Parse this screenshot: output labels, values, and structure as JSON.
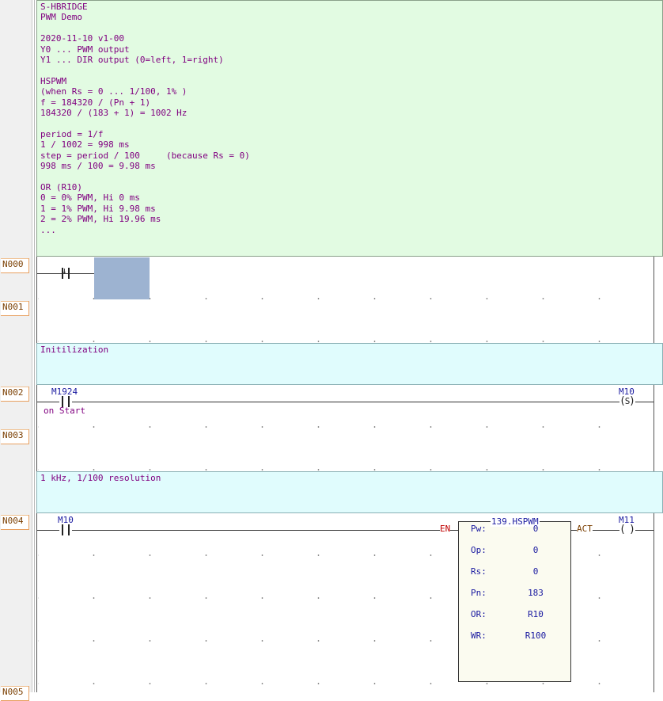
{
  "header_comment": {
    "lines": [
      "S-HBRIDGE",
      "PWM Demo",
      "",
      "2020-11-10 v1-00",
      "Y0 ... PWM output",
      "Y1 ... DIR output (0=left, 1=right)",
      "",
      "HSPWM",
      "(when Rs = 0 ... 1/100, 1% )",
      "f = 184320 / (Pn + 1)",
      "184320 / (183 + 1) = 1002 Hz",
      "",
      "period = 1/f",
      "1 / 1002 = 998 ms",
      "step = period / 100     (because Rs = 0)",
      "998 ms / 100 = 9.98 ms",
      "",
      "OR (R10)",
      "0 = 0% PWM, Hi 0 ms",
      "1 = 1% PWM, Hi 9.98 ms",
      "2 = 2% PWM, Hi 19.96 ms",
      "..."
    ]
  },
  "networks": {
    "n000": "N000",
    "n001": "N001",
    "n002": "N002",
    "n003": "N003",
    "n004": "N004",
    "n005": "N005"
  },
  "comments": {
    "init": "Initilization",
    "pwm": "1 kHz, 1/100 resolution"
  },
  "rung2": {
    "contact_name": "M1924",
    "contact_note": "on Start",
    "coil_name": "M10",
    "coil_symbol": "S"
  },
  "rung4": {
    "contact_name": "M10",
    "coil_name": "M11",
    "en_label": "EN",
    "act_label": "ACT",
    "function_block": {
      "title": "139.HSPWM",
      "params": [
        {
          "label": "Pw:",
          "value": "0"
        },
        {
          "label": "Op:",
          "value": "0"
        },
        {
          "label": "Rs:",
          "value": "0"
        },
        {
          "label": "Pn:",
          "value": "183"
        },
        {
          "label": "OR:",
          "value": "R10"
        },
        {
          "label": "WR:",
          "value": "R100"
        }
      ]
    }
  }
}
